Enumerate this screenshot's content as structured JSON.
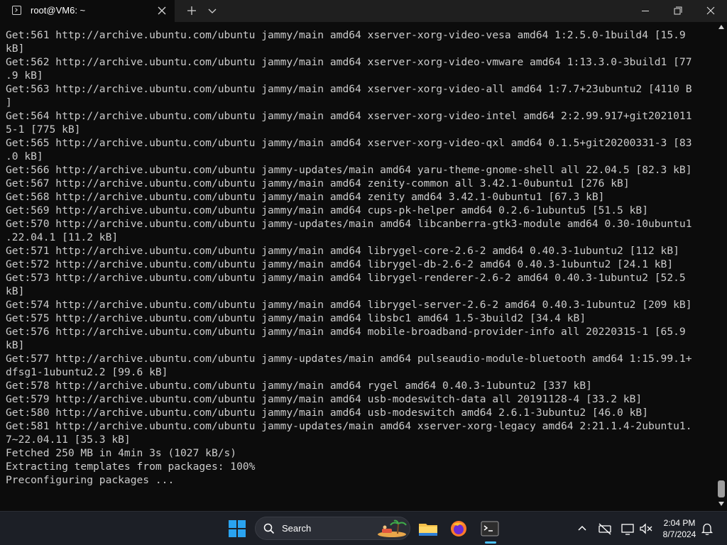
{
  "window": {
    "tab_title": "root@VM6: ~"
  },
  "terminal": {
    "lines": [
      "Get:561 http://archive.ubuntu.com/ubuntu jammy/main amd64 xserver-xorg-video-vesa amd64 1:2.5.0-1build4 [15.9",
      "kB]",
      "Get:562 http://archive.ubuntu.com/ubuntu jammy/main amd64 xserver-xorg-video-vmware amd64 1:13.3.0-3build1 [77",
      ".9 kB]",
      "Get:563 http://archive.ubuntu.com/ubuntu jammy/main amd64 xserver-xorg-video-all amd64 1:7.7+23ubuntu2 [4110 B",
      "]",
      "Get:564 http://archive.ubuntu.com/ubuntu jammy/main amd64 xserver-xorg-video-intel amd64 2:2.99.917+git2021011",
      "5-1 [775 kB]",
      "Get:565 http://archive.ubuntu.com/ubuntu jammy/main amd64 xserver-xorg-video-qxl amd64 0.1.5+git20200331-3 [83",
      ".0 kB]",
      "Get:566 http://archive.ubuntu.com/ubuntu jammy-updates/main amd64 yaru-theme-gnome-shell all 22.04.5 [82.3 kB]",
      "Get:567 http://archive.ubuntu.com/ubuntu jammy/main amd64 zenity-common all 3.42.1-0ubuntu1 [276 kB]",
      "Get:568 http://archive.ubuntu.com/ubuntu jammy/main amd64 zenity amd64 3.42.1-0ubuntu1 [67.3 kB]",
      "Get:569 http://archive.ubuntu.com/ubuntu jammy/main amd64 cups-pk-helper amd64 0.2.6-1ubuntu5 [51.5 kB]",
      "Get:570 http://archive.ubuntu.com/ubuntu jammy-updates/main amd64 libcanberra-gtk3-module amd64 0.30-10ubuntu1",
      ".22.04.1 [11.2 kB]",
      "Get:571 http://archive.ubuntu.com/ubuntu jammy/main amd64 librygel-core-2.6-2 amd64 0.40.3-1ubuntu2 [112 kB]",
      "Get:572 http://archive.ubuntu.com/ubuntu jammy/main amd64 librygel-db-2.6-2 amd64 0.40.3-1ubuntu2 [24.1 kB]",
      "Get:573 http://archive.ubuntu.com/ubuntu jammy/main amd64 librygel-renderer-2.6-2 amd64 0.40.3-1ubuntu2 [52.5",
      "kB]",
      "Get:574 http://archive.ubuntu.com/ubuntu jammy/main amd64 librygel-server-2.6-2 amd64 0.40.3-1ubuntu2 [209 kB]",
      "Get:575 http://archive.ubuntu.com/ubuntu jammy/main amd64 libsbc1 amd64 1.5-3build2 [34.4 kB]",
      "Get:576 http://archive.ubuntu.com/ubuntu jammy/main amd64 mobile-broadband-provider-info all 20220315-1 [65.9",
      "kB]",
      "Get:577 http://archive.ubuntu.com/ubuntu jammy-updates/main amd64 pulseaudio-module-bluetooth amd64 1:15.99.1+",
      "dfsg1-1ubuntu2.2 [99.6 kB]",
      "Get:578 http://archive.ubuntu.com/ubuntu jammy/main amd64 rygel amd64 0.40.3-1ubuntu2 [337 kB]",
      "Get:579 http://archive.ubuntu.com/ubuntu jammy/main amd64 usb-modeswitch-data all 20191128-4 [33.2 kB]",
      "Get:580 http://archive.ubuntu.com/ubuntu jammy/main amd64 usb-modeswitch amd64 2.6.1-3ubuntu2 [46.0 kB]",
      "Get:581 http://archive.ubuntu.com/ubuntu jammy-updates/main amd64 xserver-xorg-legacy amd64 2:21.1.4-2ubuntu1.",
      "7~22.04.11 [35.3 kB]",
      "Fetched 250 MB in 4min 3s (1027 kB/s)",
      "Extracting templates from packages: 100%",
      "Preconfiguring packages ..."
    ]
  },
  "taskbar": {
    "search_label": "Search",
    "time": "2:04 PM",
    "date": "8/7/2024"
  },
  "colors": {
    "terminal_bg": "#0c0c0c",
    "terminal_fg": "#cccccc",
    "taskbar_bg": "#1c1f26",
    "accent": "#4cc2ff"
  }
}
